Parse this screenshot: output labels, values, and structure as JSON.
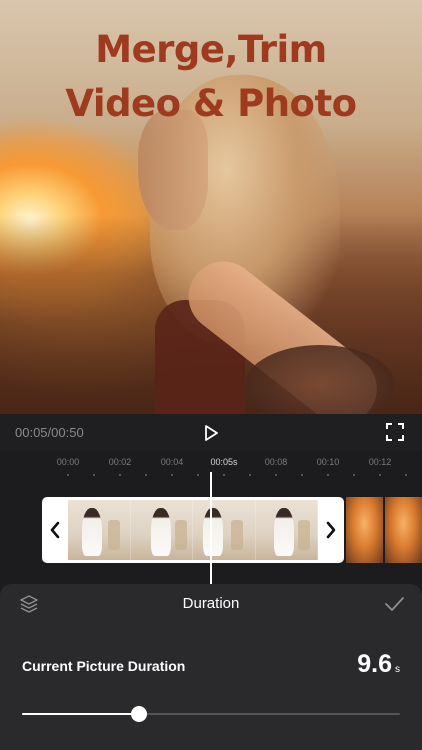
{
  "hero": {
    "headline_line1": "Merge,Trim",
    "headline_line2": "Video & Photo"
  },
  "player": {
    "current_time": "00:05",
    "separator": "/",
    "total_time": "00:50",
    "play_icon": "play-icon",
    "fullscreen_icon": "fullscreen-icon"
  },
  "timeline": {
    "ticks": [
      "00:00",
      "00:02",
      "00:04",
      "00:05",
      "00:08",
      "00:10",
      "00:12"
    ],
    "active_tick": "00:05",
    "active_tick_suffix": "s",
    "prev_icon": "chevron-left-icon",
    "next_icon": "chevron-right-icon"
  },
  "panel": {
    "title": "Duration",
    "layers_icon": "layers-icon",
    "confirm_icon": "checkmark-icon",
    "duration_label": "Current Picture Duration",
    "duration_value": "9.6",
    "duration_unit": "s",
    "slider_fraction": 0.31
  },
  "colors": {
    "headline": "#9e3a1e",
    "background": "#1c1c1e",
    "panel": "#2a2a2c"
  }
}
